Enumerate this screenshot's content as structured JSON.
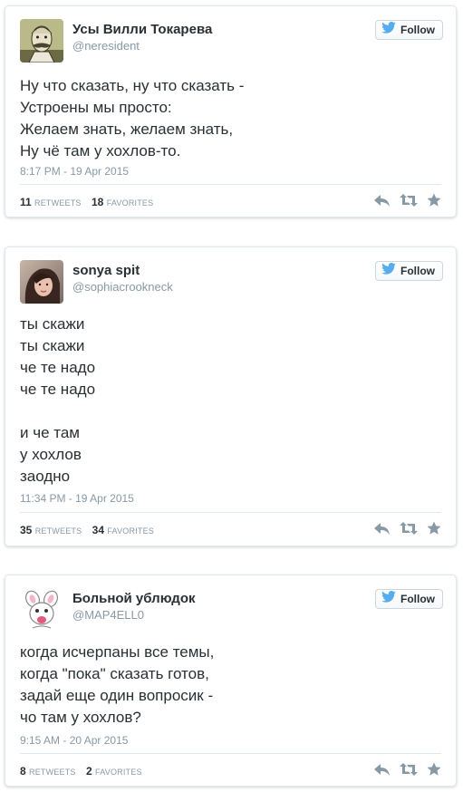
{
  "colors": {
    "twitter_blue": "#55acee",
    "action_gray": "#8899a6"
  },
  "follow_label": "Follow",
  "tweets": [
    {
      "display_name": "Усы Вилли Токарева",
      "screen_name": "@neresident",
      "avatar": "mustached-man-drawing",
      "text": "Ну что сказать, ну что сказать -\nУстроены мы просто:\nЖелаем знать, желаем знать,\nНу чё там у хохлов-то.",
      "timestamp": "8:17 PM - 19 Apr 2015",
      "retweets": "11",
      "retweets_label": "RETWEETS",
      "favorites": "18",
      "favorites_label": "FAVORITES"
    },
    {
      "display_name": "sonya spit",
      "screen_name": "@sophiacrookneck",
      "avatar": "woman-photo",
      "text": "ты скажи\nты скажи\nче те надо\nче те надо\n\nи че там\nу хохлов\nзаодно",
      "timestamp": "11:34 PM - 19 Apr 2015",
      "retweets": "35",
      "retweets_label": "RETWEETS",
      "favorites": "34",
      "favorites_label": "FAVORITES"
    },
    {
      "display_name": "Больной ублюдок",
      "screen_name": "@MAP4ELL0",
      "avatar": "white-rabbit-cartoon",
      "text": "когда исчерпаны все темы,\nкогда \"пока\" сказать готов,\nзадай еще один вопросик -\nчо там у хохлов?",
      "timestamp": "9:15 AM - 20 Apr 2015",
      "retweets": "8",
      "retweets_label": "RETWEETS",
      "favorites": "2",
      "favorites_label": "FAVORITES"
    }
  ]
}
